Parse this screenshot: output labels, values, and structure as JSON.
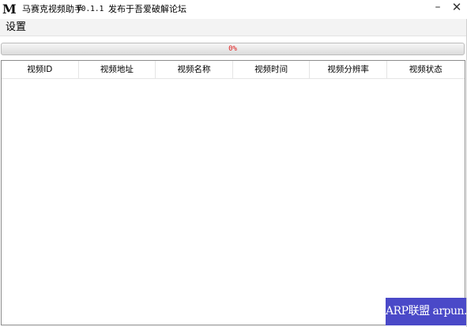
{
  "window": {
    "logo": "M",
    "title": "马赛克视频助手",
    "version": "V0.1.1",
    "subtitle": "发布于吾爱破解论坛",
    "minimize_glyph": "–",
    "close_glyph": "✕"
  },
  "menu": {
    "items": [
      {
        "label": "设置"
      }
    ]
  },
  "progress": {
    "value": 0,
    "label": "0%",
    "label_color": "#e02020"
  },
  "table": {
    "columns": [
      {
        "label": "视频ID"
      },
      {
        "label": "视频地址"
      },
      {
        "label": "视频名称"
      },
      {
        "label": "视频时间"
      },
      {
        "label": "视频分辨率"
      },
      {
        "label": "视频状态"
      }
    ],
    "rows": []
  },
  "watermark": {
    "text": "ARP联盟 arpun.com",
    "background": "#4a49c8"
  }
}
